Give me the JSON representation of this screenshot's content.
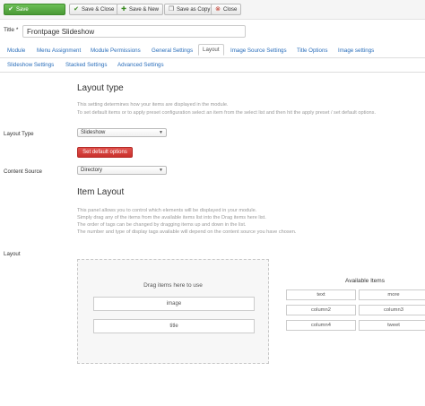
{
  "toolbar": {
    "save": "Save",
    "save_close": "Save & Close",
    "save_new": "Save & New",
    "save_copy": "Save as Copy",
    "close": "Close"
  },
  "title": {
    "label": "Title *",
    "value": "Frontpage Slideshow"
  },
  "tabs": [
    "Module",
    "Menu Assignment",
    "Module Permissions",
    "General Settings",
    "Layout",
    "Image Source Settings",
    "Title Options",
    "Image settings",
    "Slideshow Settings",
    "Stacked Settings",
    "Advanced Settings"
  ],
  "active_tab": "Layout",
  "layout_type": {
    "heading": "Layout type",
    "desc1": "This setting determines how your items are displayed in the module.",
    "desc2": "To set default items or to apply preset configuration select an item from the select list and then hit the apply preset / set default options.",
    "field_label": "Layout Type",
    "selected": "Slideshow",
    "default_button": "Set default options",
    "content_label": "Content Source",
    "content_selected": "Directory"
  },
  "item_layout": {
    "heading": "Item Layout",
    "desc1": "This panel allows you to control which elements will be displayed in your module.",
    "desc2": "Simply drag any of the items from the available items list into the Drag items here list.",
    "desc3": "The order of tags can be changed by dragging items up and down in the list.",
    "desc4": "The number and type of display tags available will depend on the content source you have chosen.",
    "field_label": "Layout",
    "drop_title": "Drag items here to use",
    "used_items": [
      "image",
      "title"
    ],
    "available_title": "Available Items",
    "available_items": [
      "text",
      "more",
      "column2",
      "column3",
      "column4",
      "tweet"
    ]
  },
  "colors": {
    "save_green": "#4a9a36",
    "danger_red": "#c9302c",
    "link_blue": "#2a6ebb"
  }
}
